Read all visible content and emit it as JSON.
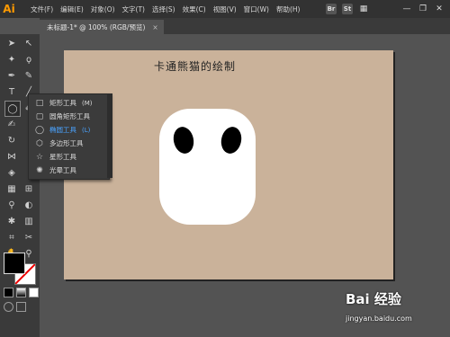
{
  "app": {
    "logo_text": "Ai"
  },
  "menu": [
    "文件(F)",
    "编辑(E)",
    "对象(O)",
    "文字(T)",
    "选择(S)",
    "效果(C)",
    "视图(V)",
    "窗口(W)",
    "帮助(H)"
  ],
  "topbar": {
    "bridge_label": "Br",
    "stock_label": "St"
  },
  "window_controls": {
    "minimize": "—",
    "restore": "❐",
    "close": "✕"
  },
  "document_tab": {
    "title": "未标题-1* @ 100% (RGB/预览)",
    "close": "×"
  },
  "artboard": {
    "title": "卡通熊猫的绘制"
  },
  "flyout": {
    "items": [
      {
        "icon": "rectangle-icon",
        "glyph": "□",
        "label": "矩形工具",
        "shortcut": "(M)",
        "active": false
      },
      {
        "icon": "rounded-rectangle-icon",
        "glyph": "▢",
        "label": "圆角矩形工具",
        "shortcut": "",
        "active": false
      },
      {
        "icon": "ellipse-icon",
        "glyph": "◯",
        "label": "椭圆工具",
        "shortcut": "(L)",
        "active": true
      },
      {
        "icon": "polygon-icon",
        "glyph": "⬡",
        "label": "多边形工具",
        "shortcut": "",
        "active": false
      },
      {
        "icon": "star-icon",
        "glyph": "☆",
        "label": "星形工具",
        "shortcut": "",
        "active": false
      },
      {
        "icon": "flare-icon",
        "glyph": "✺",
        "label": "光晕工具",
        "shortcut": "",
        "active": false
      }
    ],
    "active_color": "#4aa3ff"
  },
  "watermark": {
    "brand": "Bai 经验",
    "url": "jingyan.baidu.com"
  },
  "colors": {
    "artboard": "#cab29a",
    "workspace": "#535353",
    "panel": "#3a3a3a",
    "accent": "#ff9a00"
  }
}
